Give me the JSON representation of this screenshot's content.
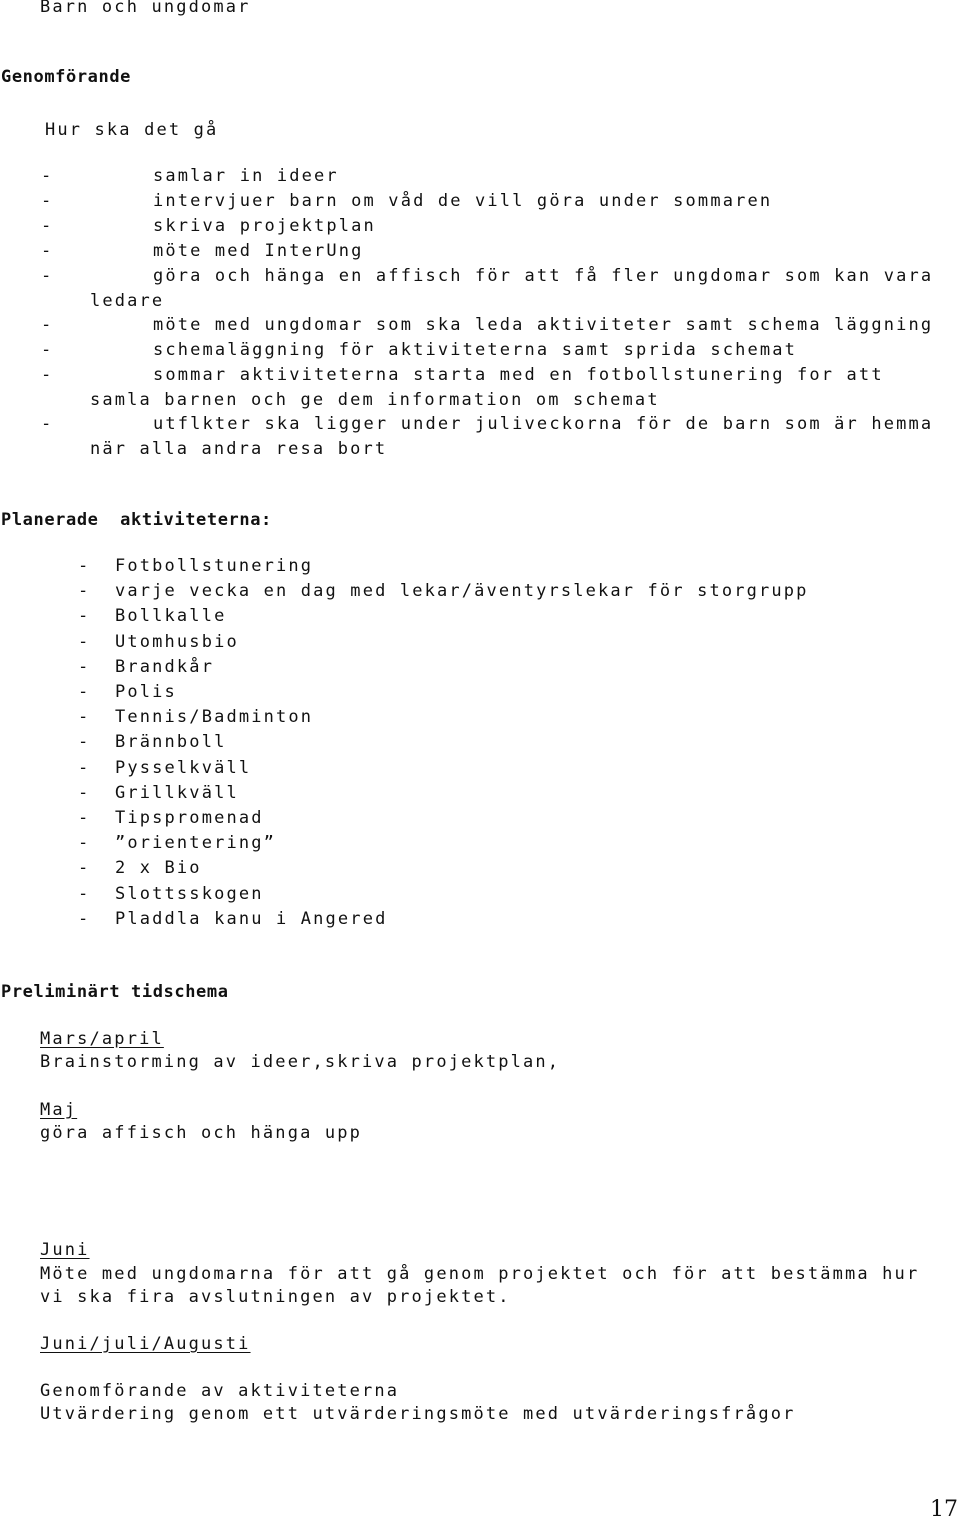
{
  "header": {
    "title": "Barn och ungdomar"
  },
  "genomforande": {
    "heading": "Genomförande",
    "subheading": "Hur ska det gå",
    "bullet": "-",
    "items": [
      {
        "lines": [
          "samlar in ideer"
        ]
      },
      {
        "lines": [
          "intervjuer barn om våd de vill göra under sommaren"
        ]
      },
      {
        "lines": [
          "skriva projektplan"
        ]
      },
      {
        "lines": [
          "möte med InterUng"
        ]
      },
      {
        "lines": [
          "göra och hänga en affisch för att få fler ungdomar som kan vara",
          "ledare"
        ]
      },
      {
        "lines": [
          "möte med ungdomar som ska leda aktiviteter samt schema läggning"
        ]
      },
      {
        "lines": [
          "schemaläggning för aktiviteterna samt sprida schemat"
        ]
      },
      {
        "lines": [
          "sommar aktiviteterna starta med en fotbollstunering for att",
          "samla barnen och ge dem information om schemat"
        ]
      },
      {
        "lines": [
          "utflkter ska ligger under juliveckorna för de barn som är hemma",
          "när alla andra resa bort"
        ]
      }
    ]
  },
  "planerade": {
    "heading": "Planerade  aktiviteterna:",
    "bullet": "-",
    "items": [
      "Fotbollstunering",
      "varje vecka en dag med lekar/äventyrslekar för storgrupp",
      "Bollkalle",
      "Utomhusbio",
      "Brandkår",
      "Polis",
      "Tennis/Badminton",
      "Brännboll",
      "Pysselkväll",
      "Grillkväll",
      "Tipspromenad",
      "”orientering”",
      "2 x Bio",
      "Slottsskogen",
      "Pladdla kanu i Angered"
    ]
  },
  "tidschema": {
    "heading": "Preliminärt tidschema",
    "periods": [
      {
        "label": "Mars/april",
        "lines": [
          "Brainstorming av ideer,skriva projektplan,"
        ]
      },
      {
        "label": "Maj",
        "lines": [
          "göra affisch och hänga upp"
        ]
      },
      {
        "label": "Juni",
        "lines": [
          "Möte med ungdomarna för att gå genom projektet och för att bestämma hur",
          "vi ska fira avslutningen av projektet."
        ]
      },
      {
        "label": "Juni/juli/Augusti",
        "lines": [
          "Genomförande av aktiviteterna",
          "Utvärdering genom ett utvärderingsmöte med utvärderingsfrågor"
        ]
      }
    ]
  },
  "footer": {
    "page_number": "17"
  }
}
